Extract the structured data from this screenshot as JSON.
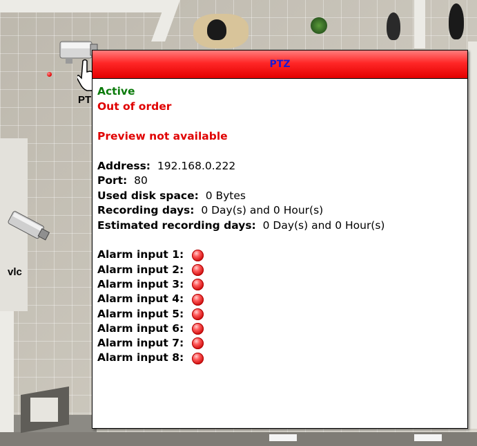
{
  "cameras": [
    {
      "label": "PT",
      "icon": "ptz-camera-icon"
    },
    {
      "label": "vlc",
      "icon": "fixed-camera-icon"
    }
  ],
  "popup": {
    "title": "PTZ",
    "status_active": "Active",
    "status_error": "Out of order",
    "preview_message": "Preview not available",
    "info": [
      {
        "label": "Address:",
        "value": "192.168.0.222"
      },
      {
        "label": "Port:",
        "value": "80"
      },
      {
        "label": "Used disk space:",
        "value": "0 Bytes"
      },
      {
        "label": "Recording days:",
        "value": "0 Day(s) and 0 Hour(s)"
      },
      {
        "label": "Estimated recording days:",
        "value": "0 Day(s) and 0 Hour(s)"
      }
    ],
    "alarm_inputs": [
      {
        "label": "Alarm input 1:",
        "state_icon": "red-led-icon"
      },
      {
        "label": "Alarm input 2:",
        "state_icon": "red-led-icon"
      },
      {
        "label": "Alarm input 3:",
        "state_icon": "red-led-icon"
      },
      {
        "label": "Alarm input 4:",
        "state_icon": "red-led-icon"
      },
      {
        "label": "Alarm input 5:",
        "state_icon": "red-led-icon"
      },
      {
        "label": "Alarm input 6:",
        "state_icon": "red-led-icon"
      },
      {
        "label": "Alarm input 7:",
        "state_icon": "red-led-icon"
      },
      {
        "label": "Alarm input 8:",
        "state_icon": "red-led-icon"
      }
    ]
  },
  "colors": {
    "header_red": "#ff2727",
    "title_blue": "#1a1ad0",
    "active_green": "#0a7a0a",
    "error_red": "#e00000"
  }
}
